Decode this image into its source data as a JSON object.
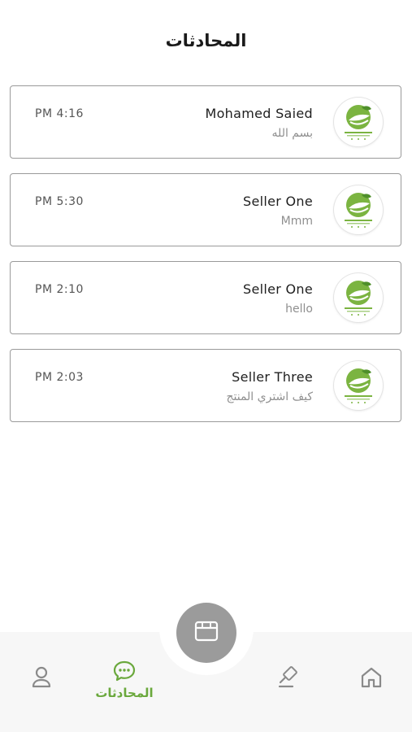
{
  "header": {
    "title": "المحادثات"
  },
  "colors": {
    "accent": "#6aa83c",
    "card_border": "#9a9a9a",
    "fab": "#9b9b9b",
    "icon_inactive": "#8a8a8a"
  },
  "chats": [
    {
      "name": "Mohamed Saied",
      "preview": "بسم الله",
      "time": "PM 4:16",
      "avatar_icon": "leaf-logo-icon"
    },
    {
      "name": "Seller One",
      "preview": "Mmm",
      "time": "PM 5:30",
      "avatar_icon": "leaf-logo-icon"
    },
    {
      "name": "Seller One",
      "preview": "hello",
      "time": "PM 2:10",
      "avatar_icon": "leaf-logo-icon"
    },
    {
      "name": "Seller Three",
      "preview": "كيف اشتري المنتج",
      "time": "PM 2:03",
      "avatar_icon": "leaf-logo-icon"
    }
  ],
  "bottom_nav": {
    "home_icon": "home-icon",
    "auction_icon": "gavel-icon",
    "store_icon": "store-icon",
    "chats_icon": "chat-bubble-icon",
    "chats_label": "المحادثات",
    "profile_icon": "user-icon",
    "active": "chats"
  }
}
